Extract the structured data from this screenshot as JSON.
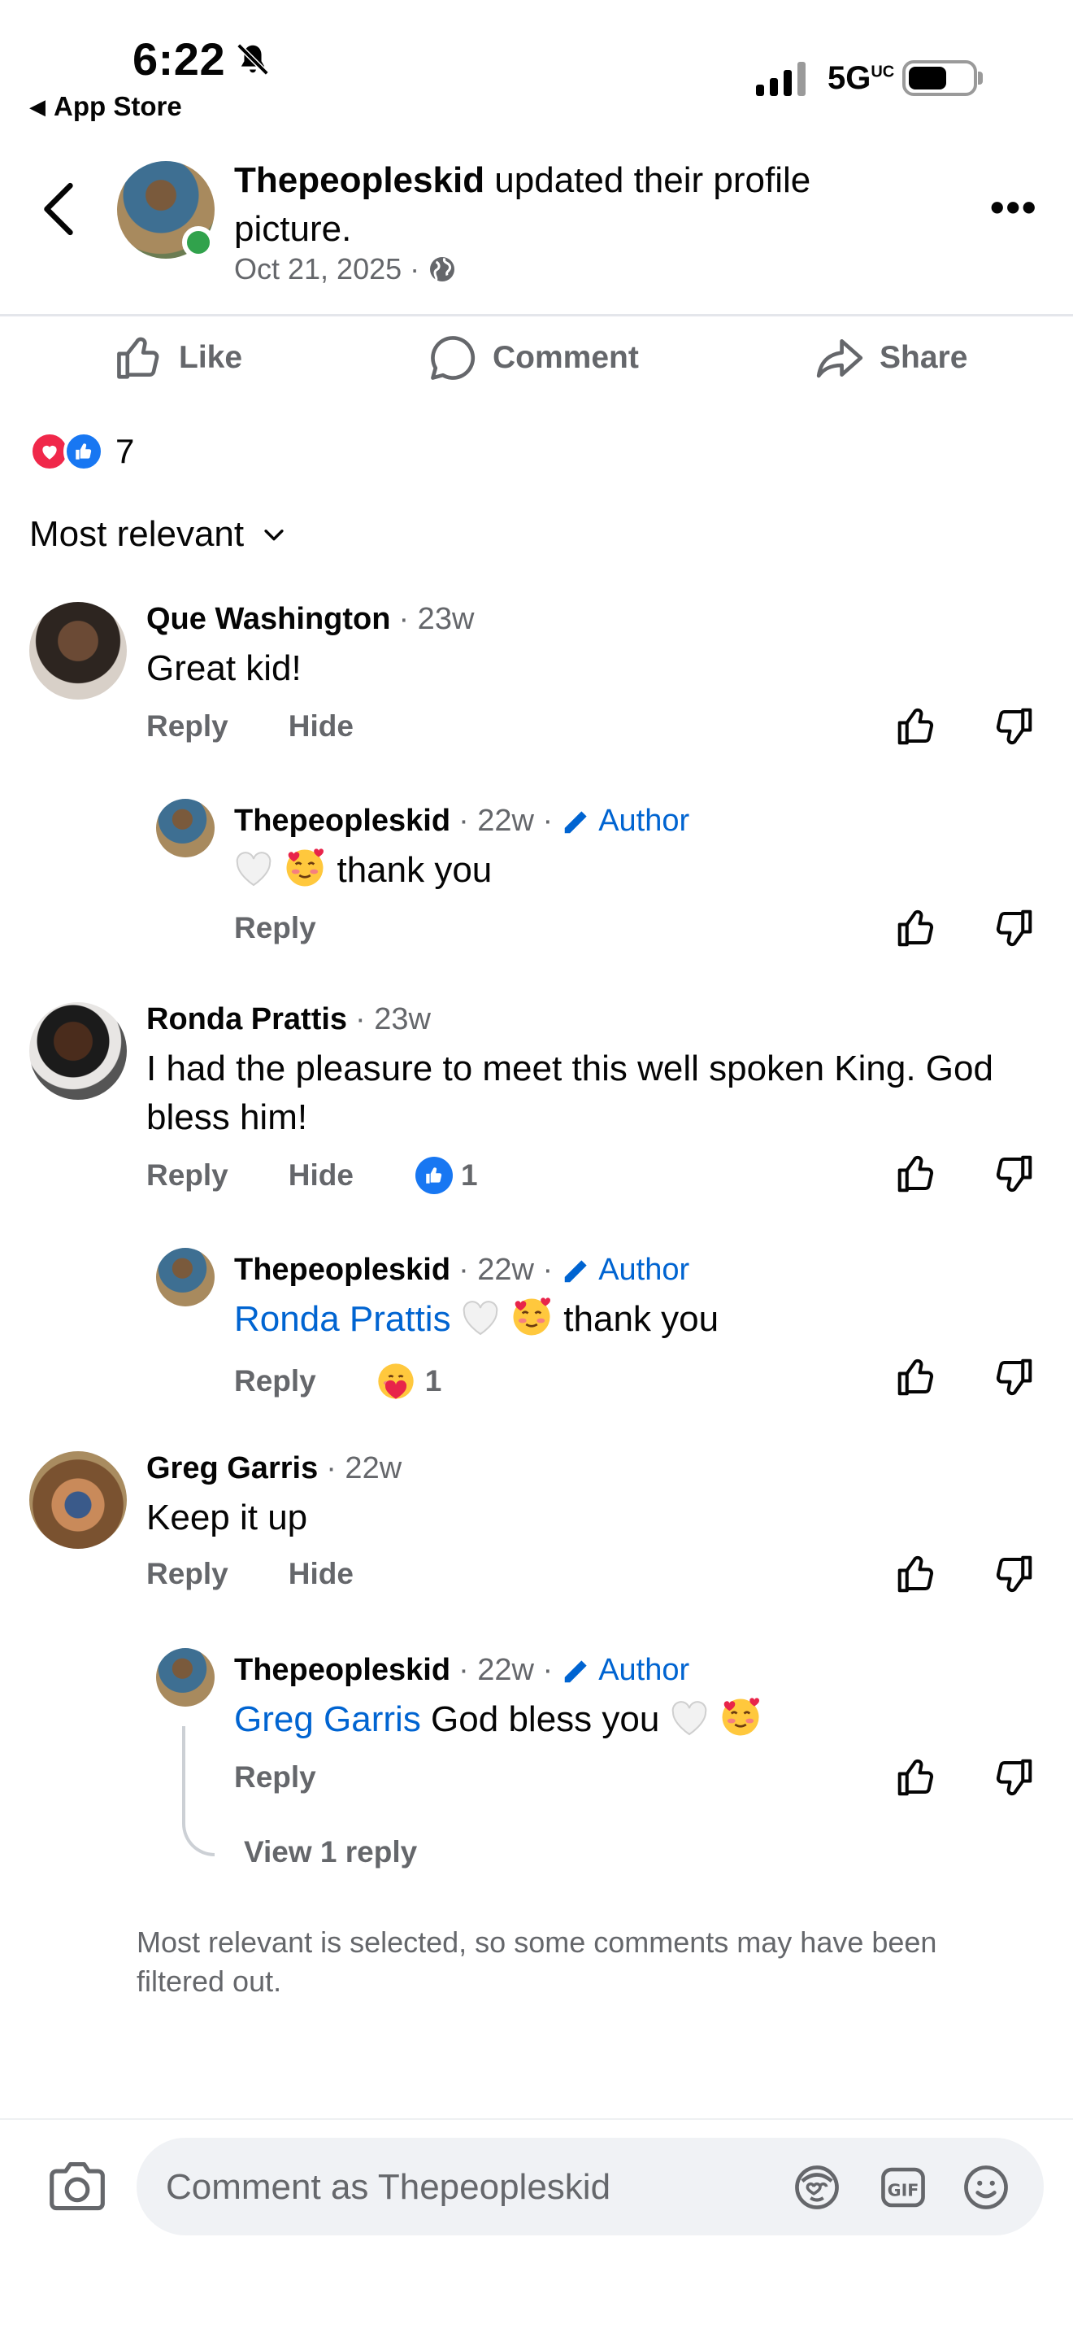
{
  "status_bar": {
    "time": "6:22",
    "back_label": "App Store",
    "network": "5G",
    "network_sup": "UC"
  },
  "header": {
    "author_name": "Thepeopleskid",
    "action_text": " updated their profile picture.",
    "date": "Oct 21, 2025",
    "separator": "·"
  },
  "actions": {
    "like": "Like",
    "comment": "Comment",
    "share": "Share"
  },
  "reactions": {
    "count": "7"
  },
  "sort": {
    "label": "Most relevant"
  },
  "comments": [
    {
      "name": "Que Washington",
      "time": "· 23w",
      "text": "Great kid!",
      "reply": "Reply",
      "hide": "Hide"
    },
    {
      "name": "Thepeopleskid",
      "time": "· 22w ·",
      "author": "Author",
      "text": " thank you",
      "reply": "Reply"
    },
    {
      "name": "Ronda Prattis",
      "time": "· 23w",
      "text": "I had the pleasure to meet this well spoken King. God bless him!",
      "reply": "Reply",
      "hide": "Hide",
      "like_count": "1"
    },
    {
      "name": "Thepeopleskid",
      "time": "· 22w ·",
      "author": "Author",
      "mention": "Ronda Prattis",
      "text": " thank you",
      "reply": "Reply",
      "react_count": "1"
    },
    {
      "name": "Greg Garris",
      "time": "· 22w",
      "text": "Keep it up",
      "reply": "Reply",
      "hide": "Hide"
    },
    {
      "name": "Thepeopleskid",
      "time": "· 22w ·",
      "author": "Author",
      "mention": "Greg Garris",
      "text": " God bless you ",
      "reply": "Reply",
      "view_replies": "View 1 reply"
    }
  ],
  "filter_note": "Most relevant is selected, so some comments may have been filtered out.",
  "composer": {
    "placeholder": "Comment as Thepeopleskid"
  },
  "colors": {
    "link_blue": "#0064d1",
    "like_blue": "#1877f2",
    "love_red": "#f0284a",
    "online_green": "#31a24c",
    "muted": "#65676b"
  }
}
